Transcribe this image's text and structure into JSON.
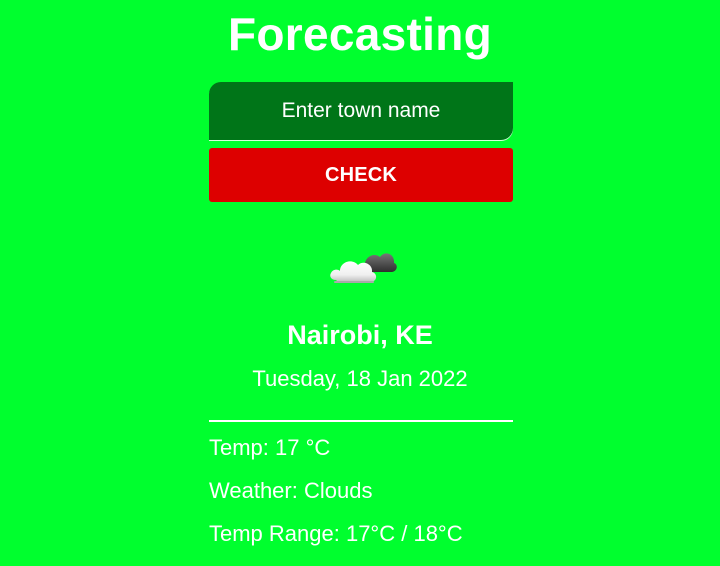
{
  "page": {
    "title": "Forecasting"
  },
  "search": {
    "placeholder": "Enter town name",
    "button_label": "CHECK"
  },
  "weather": {
    "icon": "cloud-icon",
    "location": "Nairobi, KE",
    "date": "Tuesday, 18 Jan 2022",
    "temp_label": "Temp: 17 °C",
    "condition_label": "Weather: Clouds",
    "range_label": "Temp Range: 17°C / 18°C"
  },
  "colors": {
    "background": "#00ff2e",
    "input_background": "#007518",
    "button_background": "#dd0000",
    "text": "#ffffff"
  }
}
